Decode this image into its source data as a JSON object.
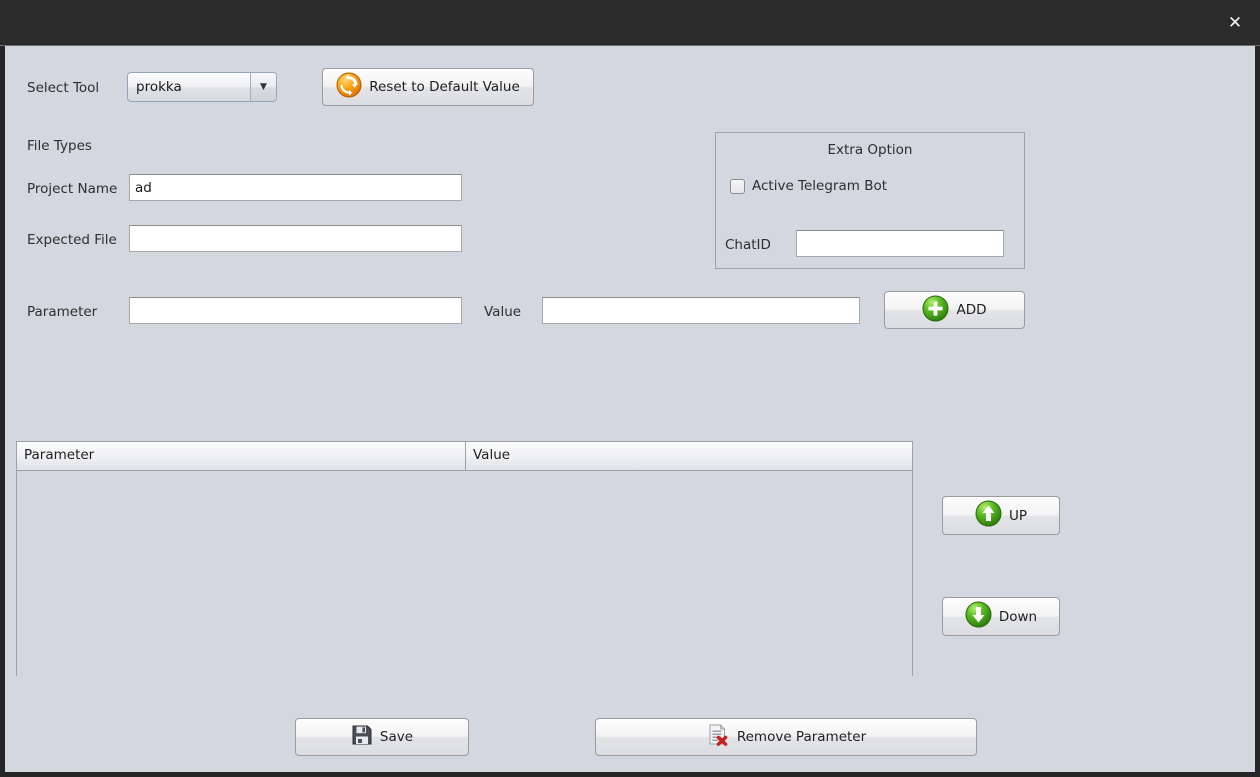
{
  "window": {
    "close_label": "✕"
  },
  "toolbar": {
    "select_tool_label": "Select Tool",
    "tool_value": "prokka",
    "dropdown_arrow": "▼",
    "reset_label": "Reset to Default Value",
    "reset_icon": "refresh-icon"
  },
  "form": {
    "file_types_label": "File Types",
    "project_name_label": "Project Name",
    "project_name_value": "ad",
    "expected_file_label": "Expected File",
    "expected_file_value": "",
    "parameter_label": "Parameter",
    "parameter_value": "",
    "value_label": "Value",
    "value_value": "",
    "add_label": "ADD",
    "add_icon": "plus-circle-icon"
  },
  "extra_option": {
    "title": "Extra Option",
    "checkbox_label": "Active Telegram Bot",
    "checkbox_checked": false,
    "chatid_label": "ChatID",
    "chatid_value": ""
  },
  "table": {
    "columns": [
      "Parameter",
      "Value"
    ],
    "rows": []
  },
  "side_buttons": {
    "up_label": "UP",
    "up_icon": "arrow-up-circle-icon",
    "down_label": "Down",
    "down_icon": "arrow-down-circle-icon"
  },
  "bottom_buttons": {
    "save_label": "Save",
    "save_icon": "floppy-disk-icon",
    "remove_label": "Remove Parameter",
    "remove_icon": "document-delete-icon"
  },
  "colors": {
    "background": "#d3d7df",
    "titlebar": "#2b2b2b",
    "accent_green": "#4fb21f",
    "accent_orange": "#f0920f",
    "accent_red": "#c42020"
  }
}
